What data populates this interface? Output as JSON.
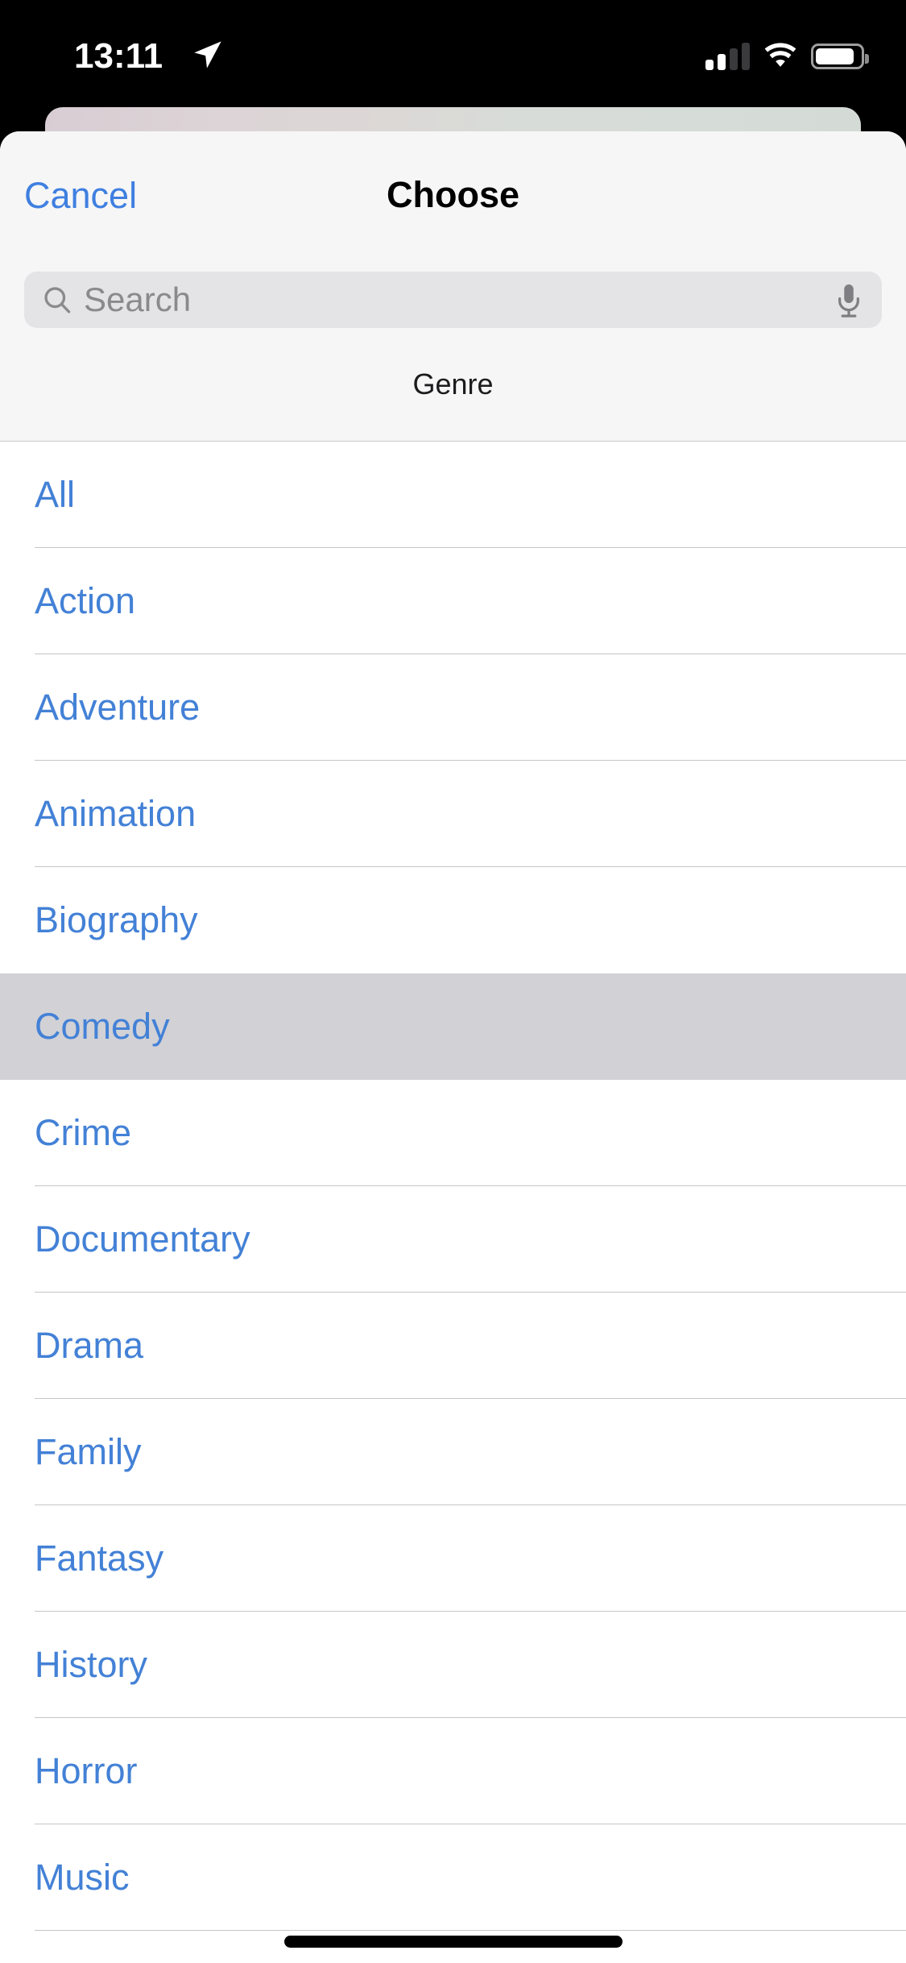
{
  "status_bar": {
    "time": "13:11",
    "location_icon": "location-arrow-icon",
    "cellular_icon": "cellular-signal-icon",
    "cellular_bars_filled": 2,
    "cellular_bars_total": 4,
    "wifi_icon": "wifi-icon",
    "battery_icon": "battery-icon"
  },
  "nav": {
    "cancel_label": "Cancel",
    "title": "Choose"
  },
  "search": {
    "placeholder": "Search",
    "value": "",
    "search_icon": "search-icon",
    "mic_icon": "microphone-icon"
  },
  "section": {
    "label": "Genre"
  },
  "colors": {
    "accent_blue": "#4381d6",
    "link_blue": "#3f7fe0",
    "selected_row": "#d1d1d6",
    "search_field": "#e4e4e6",
    "header_bg": "#f6f6f6",
    "separator": "#c6c6c8"
  },
  "genres": [
    {
      "label": "All",
      "selected": false
    },
    {
      "label": "Action",
      "selected": false
    },
    {
      "label": "Adventure",
      "selected": false
    },
    {
      "label": "Animation",
      "selected": false
    },
    {
      "label": "Biography",
      "selected": false
    },
    {
      "label": "Comedy",
      "selected": true
    },
    {
      "label": "Crime",
      "selected": false
    },
    {
      "label": "Documentary",
      "selected": false
    },
    {
      "label": "Drama",
      "selected": false
    },
    {
      "label": "Family",
      "selected": false
    },
    {
      "label": "Fantasy",
      "selected": false
    },
    {
      "label": "History",
      "selected": false
    },
    {
      "label": "Horror",
      "selected": false
    },
    {
      "label": "Music",
      "selected": false
    }
  ]
}
